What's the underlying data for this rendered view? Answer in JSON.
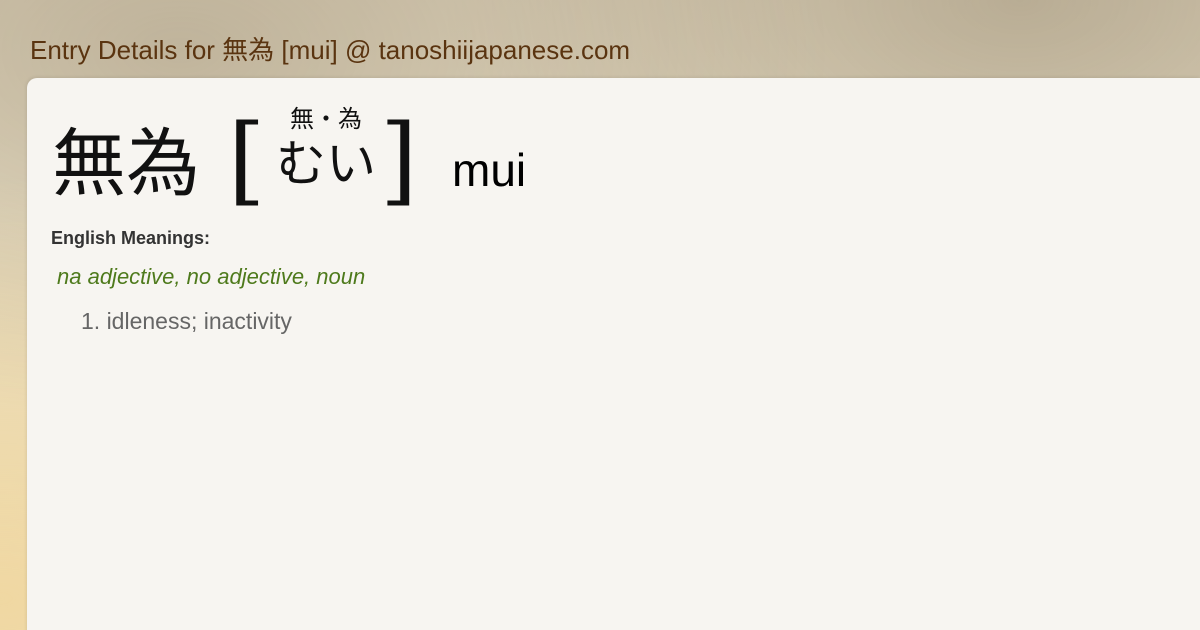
{
  "header": {
    "title": "Entry Details for 無為 [mui] @ tanoshiijapanese.com"
  },
  "entry": {
    "kanji": "無為",
    "furigana_kanji": "無・為",
    "kana": "むい",
    "romaji": "mui",
    "bracket_open": "[",
    "bracket_close": "]"
  },
  "meanings": {
    "label": "English Meanings:",
    "part_of_speech": "na adjective, no adjective, noun",
    "items": [
      "1. idleness; inactivity"
    ]
  },
  "colors": {
    "header_text": "#5a3410",
    "part_of_speech": "#4e7a1c",
    "meaning_text": "#666666",
    "panel_bg": "#f7f5f1"
  }
}
